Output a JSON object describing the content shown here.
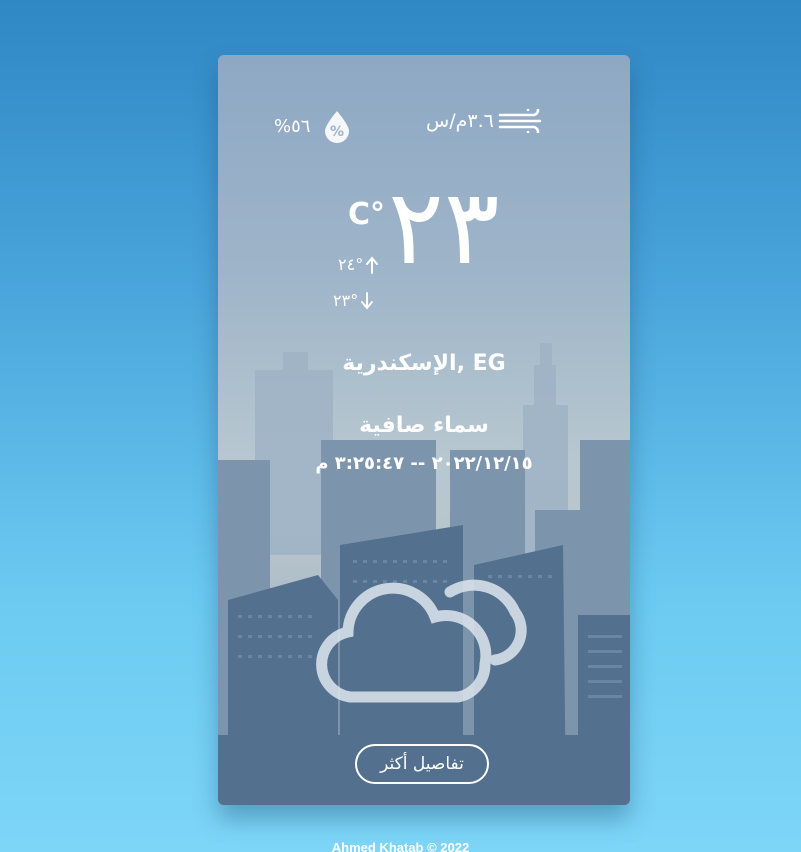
{
  "weather": {
    "wind": "٣.٦م/س",
    "humidity": "%٥٦",
    "temperature": "٢٣",
    "unit": "C°",
    "temp_max": "٢٤°",
    "temp_min": "٢٣°",
    "location": "الإسكندرية, EG",
    "condition": "سماء صافية",
    "datetime": "٢٠٢٢/١٢/١٥ -- ٣:٢٥:٤٧ م",
    "details_label": "تفاصيل أكثر"
  },
  "icons": {
    "humidity": "humidity-drop-icon",
    "wind": "wind-icon",
    "arrow_up": "arrow-up-icon",
    "arrow_down": "arrow-down-icon",
    "condition": "cloud-icon"
  },
  "footer": {
    "text": "Ahmed Khatab © 2022"
  }
}
